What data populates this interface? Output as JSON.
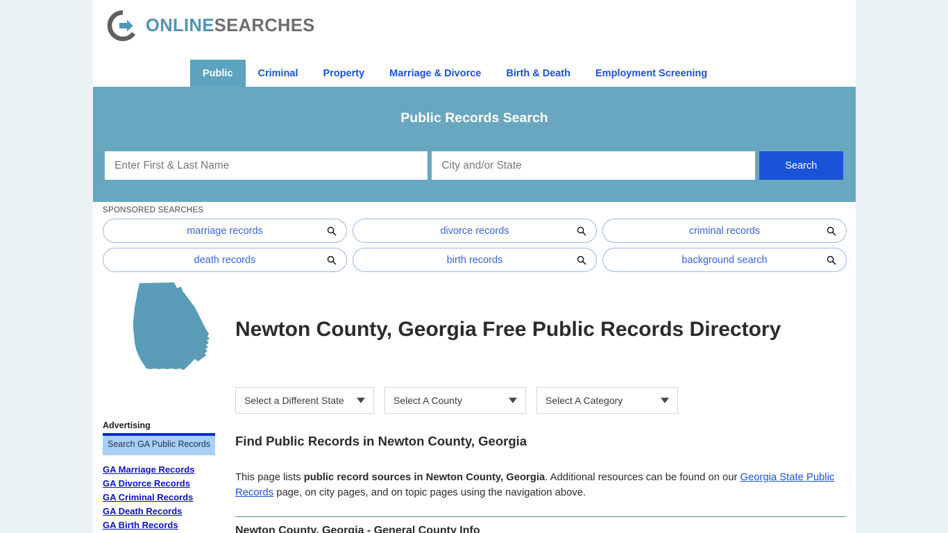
{
  "site": {
    "logo_online": "ONLINE",
    "logo_searches": "SEARCHES",
    "logo_icon": "circle-arrow-icon"
  },
  "nav": {
    "tabs": [
      {
        "label": "Public",
        "active": true
      },
      {
        "label": "Criminal",
        "active": false
      },
      {
        "label": "Property",
        "active": false
      },
      {
        "label": "Marriage & Divorce",
        "active": false
      },
      {
        "label": "Birth & Death",
        "active": false
      },
      {
        "label": "Employment Screening",
        "active": false
      }
    ]
  },
  "hero": {
    "title": "Public Records Search",
    "name_placeholder": "Enter First & Last Name",
    "name_value": "",
    "city_placeholder": "City and/or State",
    "city_value": "",
    "search_button": "Search",
    "bg_color": "#68a7bf",
    "button_color": "#1a52d8"
  },
  "sponsored": {
    "label": "SPONSORED SEARCHES",
    "rows": [
      [
        {
          "label": "marriage records"
        },
        {
          "label": "divorce records"
        },
        {
          "label": "criminal records"
        }
      ],
      [
        {
          "label": "death records"
        },
        {
          "label": "birth records"
        },
        {
          "label": "background search"
        }
      ]
    ]
  },
  "main": {
    "state_map_icon": "georgia-state-outline",
    "page_title": "Newton County, Georgia Free Public Records Directory",
    "selects": [
      {
        "label": "Select a Different State"
      },
      {
        "label": "Select A County"
      },
      {
        "label": "Select A Category"
      }
    ],
    "heading": "Find Public Records in Newton County, Georgia",
    "paragraph": {
      "part1": "This page lists ",
      "bold1": "public record sources in Newton County, Georgia",
      "part2": ". Additional resources can be found on our ",
      "link1": "Georgia State Public Records",
      "part3": " page, on city pages, and on topic pages using the navigation above."
    },
    "section_heading": "Newton County, Georgia - General County Info"
  },
  "sidebar": {
    "ad_label": "Advertising",
    "ad_text": "Search GA Public Records",
    "links": [
      {
        "label": "GA Marriage Records"
      },
      {
        "label": "GA Divorce Records"
      },
      {
        "label": "GA Criminal Records"
      },
      {
        "label": "GA Death Records"
      },
      {
        "label": "GA Birth Records"
      }
    ]
  },
  "colors": {
    "page_bg": "#eaf2f6",
    "accent_teal": "#5ba3bf",
    "link_blue": "#1a52d8",
    "map_fill": "#5a9cb8"
  }
}
